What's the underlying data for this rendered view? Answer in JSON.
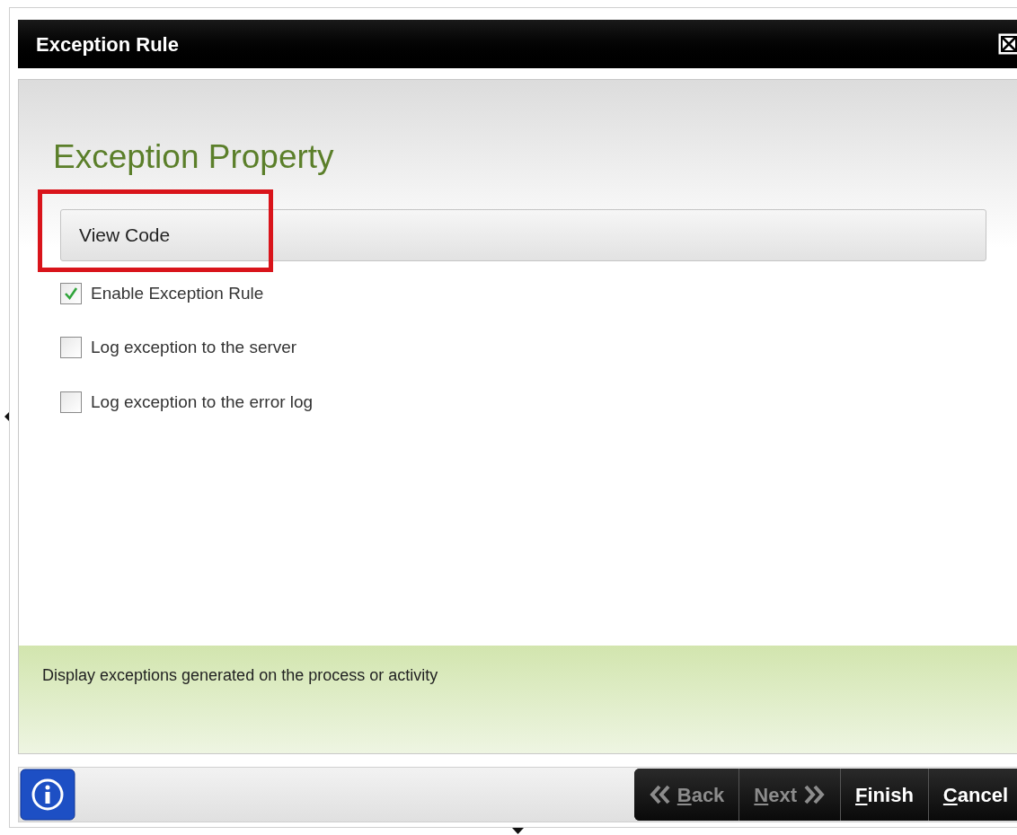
{
  "window": {
    "title": "Exception Rule"
  },
  "heading": "Exception Property",
  "view_code": {
    "label": "View Code",
    "highlighted": true
  },
  "options": [
    {
      "label": "Enable Exception Rule",
      "checked": true
    },
    {
      "label": "Log exception to the server",
      "checked": false
    },
    {
      "label": "Log exception to the error log",
      "checked": false
    }
  ],
  "help_text": "Display exceptions generated on the process or activity",
  "buttons": [
    {
      "kind": "back",
      "key": "B",
      "rest": "ack",
      "disabled": true
    },
    {
      "kind": "next",
      "key": "N",
      "rest": "ext",
      "disabled": true
    },
    {
      "kind": "plain",
      "key": "F",
      "rest": "inish",
      "disabled": false
    },
    {
      "kind": "plain",
      "key": "C",
      "rest": "ancel",
      "disabled": false
    }
  ]
}
